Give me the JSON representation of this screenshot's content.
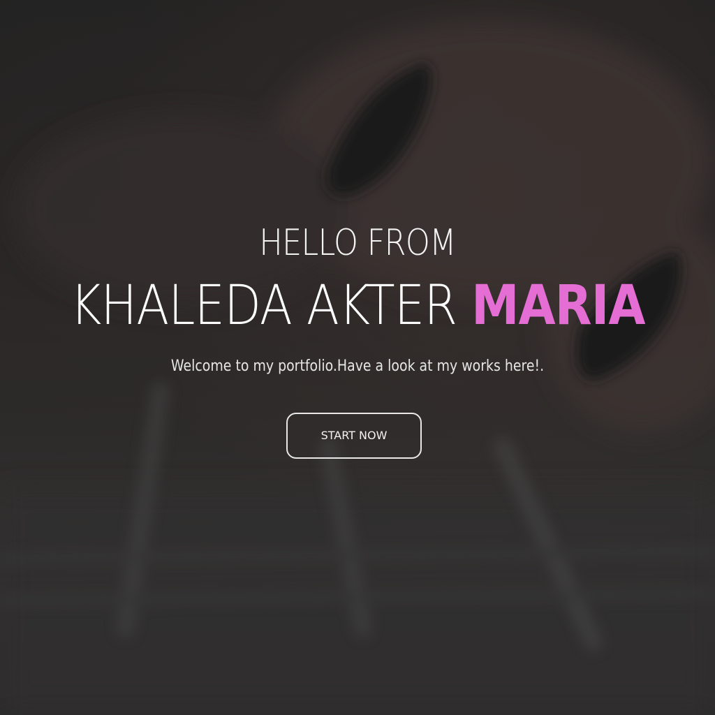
{
  "hero": {
    "greeting": "HELLO FROM",
    "name_first": "KHALEDA AKTER",
    "name_accent": "MARIA",
    "tagline": "Welcome to my portfolio.Have a look at my works here!.",
    "cta_label": "START NOW",
    "accent_color": "#e56ed4",
    "background_image": "blurred-hands-typing-on-keyboard"
  }
}
